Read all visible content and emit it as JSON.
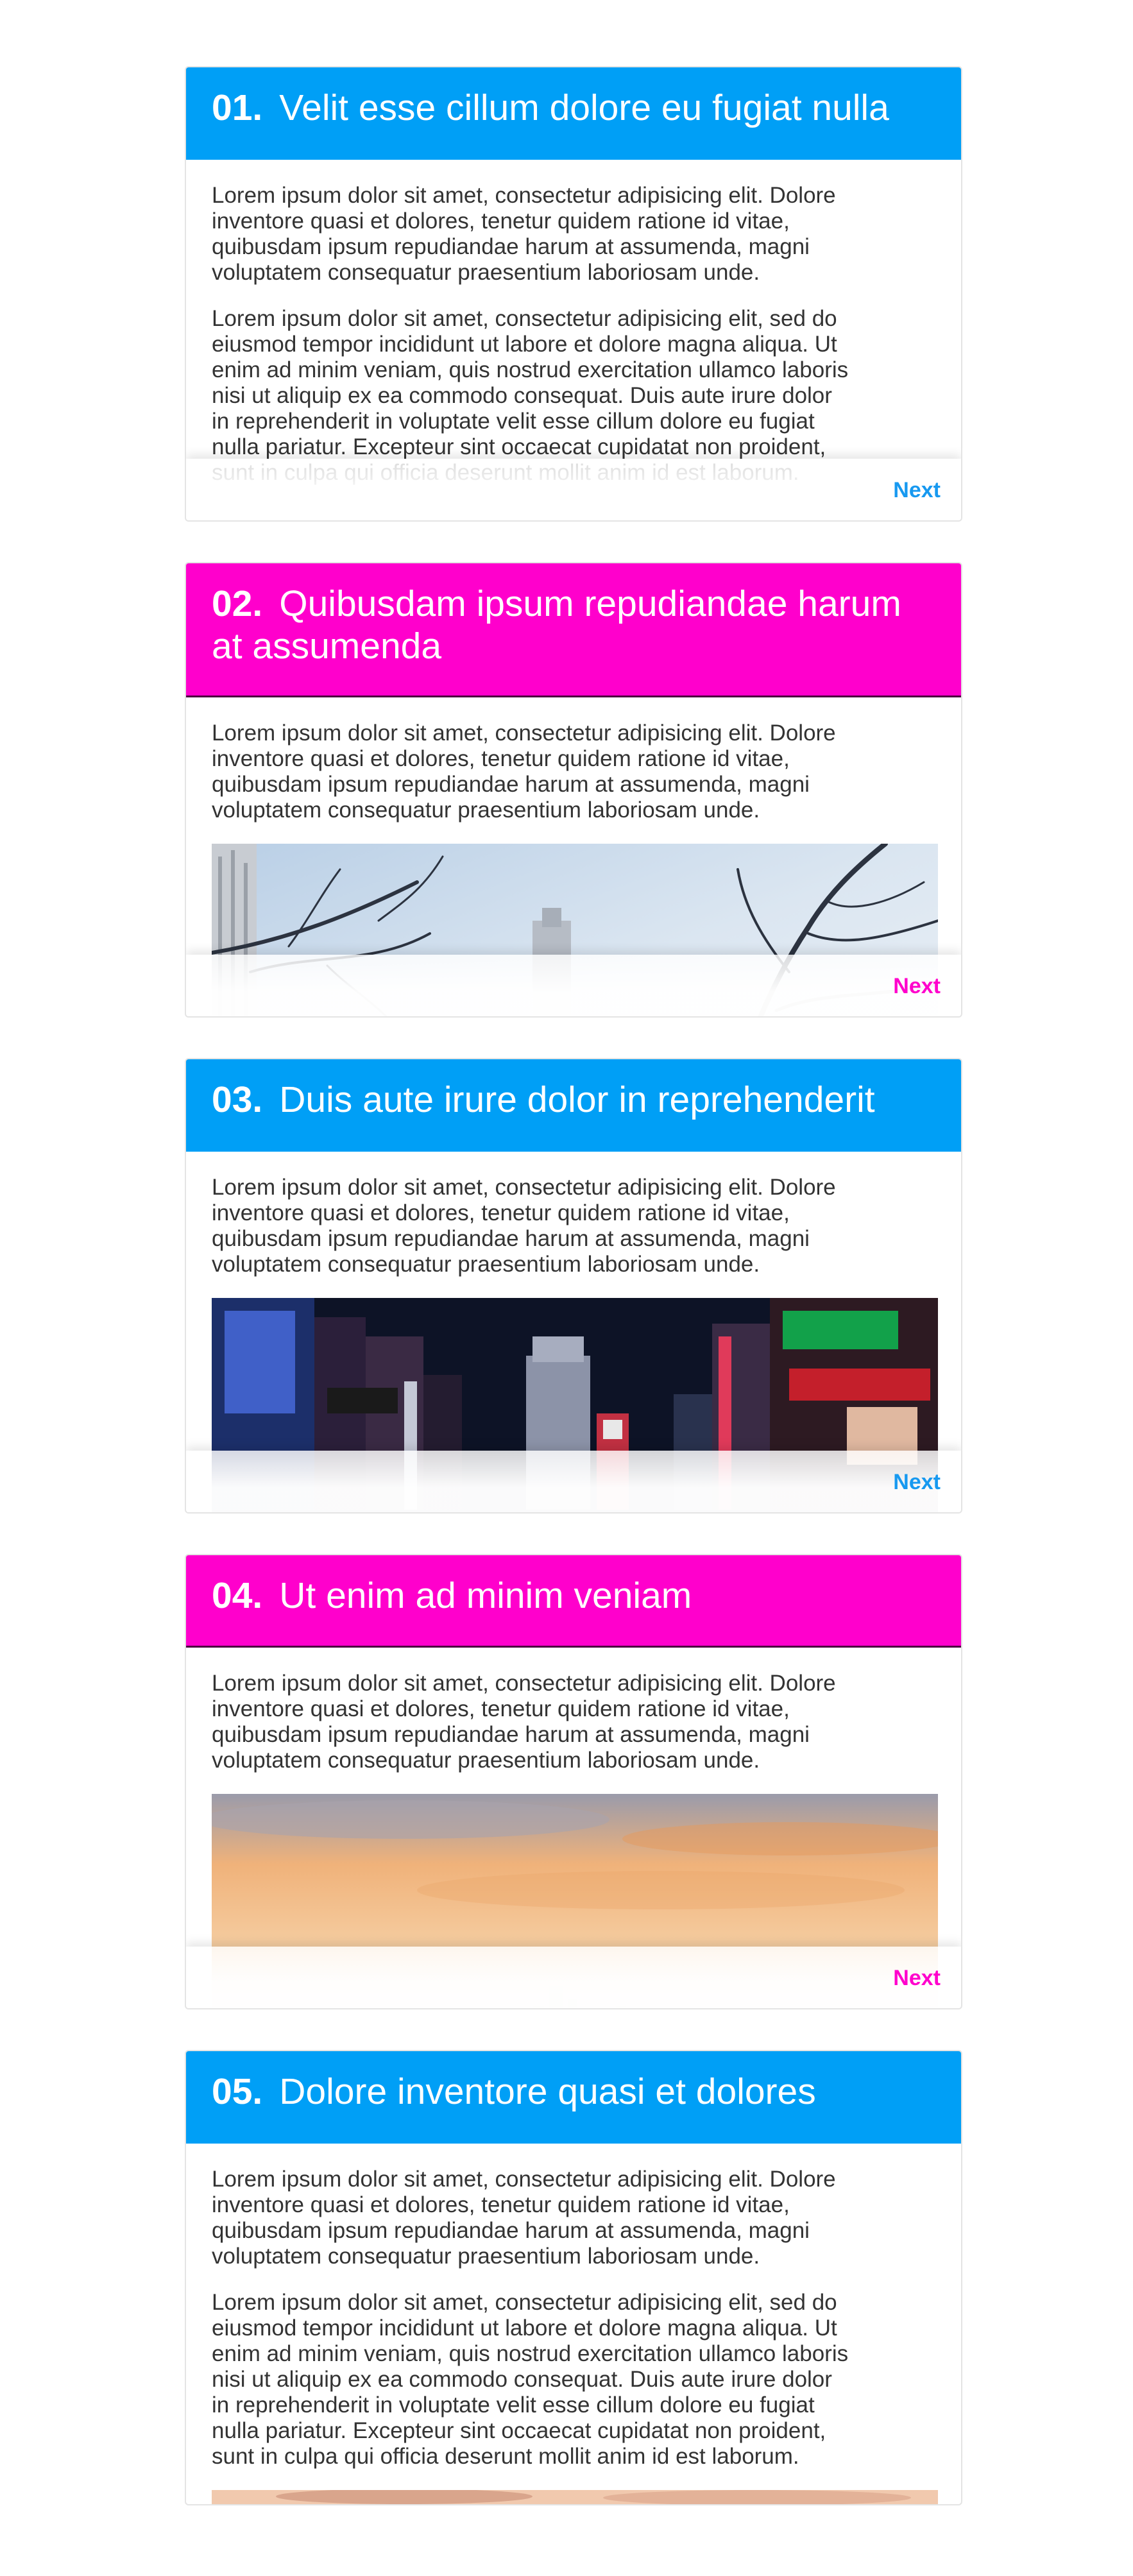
{
  "cards": [
    {
      "number": "01.",
      "title": "Velit esse cillum dolore eu fugiat nulla",
      "accent": "#009ff6",
      "paragraphs": [
        "Lorem ipsum dolor sit amet, consectetur adipisicing elit. Dolore inventore quasi et dolores, tenetur quidem ratione id vitae, quibusdam ipsum repudiandae harum at assumenda, magni voluptatem consequatur praesentium laboriosam unde.",
        "Lorem ipsum dolor sit amet, consectetur adipisicing elit, sed do eiusmod tempor incididunt ut labore et dolore magna aliqua. Ut enim ad minim veniam, quis nostrud exercitation ullamco laboris nisi ut aliquip ex ea commodo consequat. Duis aute irure dolor in reprehenderit in voluptate velit esse cillum dolore eu fugiat nulla pariatur. Excepteur sint occaecat cupidatat non proident, sunt in culpa qui officia deserunt mollit anim id est laborum."
      ],
      "next_label": "Next"
    },
    {
      "number": "02.",
      "title": "Quibusdam ipsum repudiandae harum at assumenda",
      "accent": "#ff00cc",
      "paragraphs": [
        "Lorem ipsum dolor sit amet, consectetur adipisicing elit. Dolore inventore quasi et dolores, tenetur quidem ratione id vitae, quibusdam ipsum repudiandae harum at assumenda, magni voluptatem consequatur praesentium laboriosam unde."
      ],
      "image": "tree-branches-sky-photo",
      "next_label": "Next"
    },
    {
      "number": "03.",
      "title": "Duis aute irure dolor in reprehenderit",
      "accent": "#009ff6",
      "paragraphs": [
        "Lorem ipsum dolor sit amet, consectetur adipisicing elit. Dolore inventore quasi et dolores, tenetur quidem ratione id vitae, quibusdam ipsum repudiandae harum at assumenda, magni voluptatem consequatur praesentium laboriosam unde."
      ],
      "image": "city-street-night-photo",
      "next_label": "Next"
    },
    {
      "number": "04.",
      "title": "Ut enim ad minim veniam",
      "accent": "#ff00cc",
      "paragraphs": [
        "Lorem ipsum dolor sit amet, consectetur adipisicing elit. Dolore inventore quasi et dolores, tenetur quidem ratione id vitae, quibusdam ipsum repudiandae harum at assumenda, magni voluptatem consequatur praesentium laboriosam unde."
      ],
      "image": "sunset-skyline-photo",
      "next_label": "Next"
    },
    {
      "number": "05.",
      "title": "Dolore inventore quasi et dolores",
      "accent": "#009ff6",
      "paragraphs": [
        "Lorem ipsum dolor sit amet, consectetur adipisicing elit. Dolore inventore quasi et dolores, tenetur quidem ratione id vitae, quibusdam ipsum repudiandae harum at assumenda, magni voluptatem consequatur praesentium laboriosam unde.",
        "Lorem ipsum dolor sit amet, consectetur adipisicing elit, sed do eiusmod tempor incididunt ut labore et dolore magna aliqua. Ut enim ad minim veniam, quis nostrud exercitation ullamco laboris nisi ut aliquip ex ea commodo consequat. Duis aute irure dolor in reprehenderit in voluptate velit esse cillum dolore eu fugiat nulla pariatur. Excepteur sint occaecat cupidatat non proident, sunt in culpa qui officia deserunt mollit anim id est laborum."
      ]
    }
  ]
}
